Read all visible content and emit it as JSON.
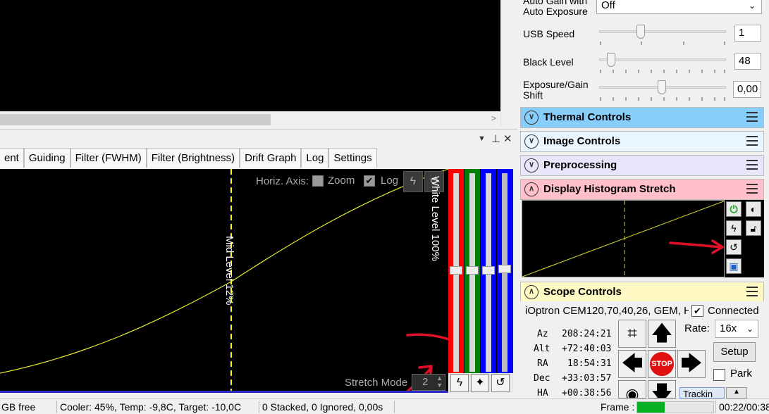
{
  "colors": {
    "accent_red": "#ff0000",
    "thermal_bg": "#87cefa",
    "display_bg": "#ffb6c1",
    "scope_bg": "#fff9c4"
  },
  "panel_buttons": {
    "dropdown": "▼",
    "pin": "⊥",
    "close": "✕"
  },
  "tabs": [
    "ent",
    "Guiding",
    "Filter (FWHM)",
    "Filter (Brightness)",
    "Drift Graph",
    "Log",
    "Settings"
  ],
  "plot": {
    "horiz_axis": "Horiz. Axis:",
    "zoom": "Zoom",
    "log": "Log",
    "log_checked": true,
    "mid_level": "Mid Level  12%",
    "white_level": "White Level  100%",
    "stretch_mode_label": "Stretch Mode",
    "stretch_mode_value": "2"
  },
  "camera": {
    "auto_gain_label": "Auto Gain with Auto Exposure",
    "auto_gain_value": "Off",
    "usb_speed_label": "USB Speed",
    "usb_speed_value": "1",
    "black_level_label": "Black Level",
    "black_level_value": "48",
    "exposure_shift_label": "Exposure/Gain Shift",
    "exposure_shift_value": "0,00"
  },
  "sections": {
    "thermal": "Thermal Controls",
    "image": "Image Controls",
    "preprocessing": "Preprocessing",
    "display": "Display Histogram Stretch",
    "scope": "Scope Controls"
  },
  "scope": {
    "mount": "iOptron CEM120,70,40,26, GEM, H",
    "connected_label": "Connected",
    "connected": true,
    "az_label": "Az",
    "az": "208:24:21",
    "alt_label": "Alt",
    "alt": "+72:40:03",
    "ra_label": "RA",
    "ra": "18:54:31",
    "dec_label": "Dec",
    "dec": "+33:03:57",
    "ha_label": "HA",
    "ha": "+00:38:56",
    "rate_label": "Rate:",
    "rate_value": "16x",
    "setup": "Setup",
    "park": "Park",
    "stop": "STOP",
    "tracking": "Trackin"
  },
  "status": {
    "disk": "GB free",
    "cooler": "Cooler: 45%, Temp: -9,8C, Target: -10,0C",
    "stacked": "0 Stacked, 0 Ignored, 0,00s",
    "frame_label": "Frame :",
    "time": "00:22/00:38"
  }
}
